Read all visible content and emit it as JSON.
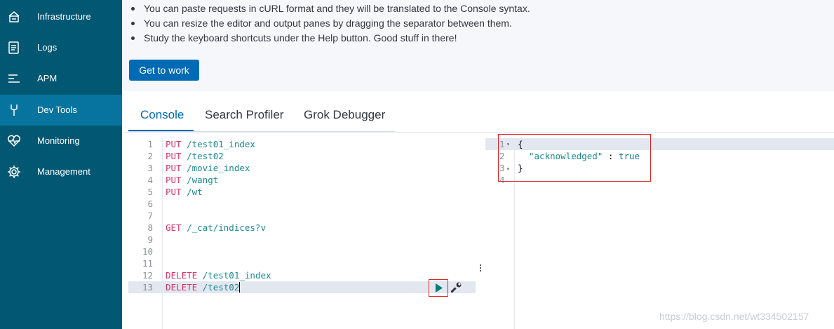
{
  "sidebar": {
    "items": [
      {
        "label": "Infrastructure",
        "icon": "infrastructure-icon"
      },
      {
        "label": "Logs",
        "icon": "logs-icon"
      },
      {
        "label": "APM",
        "icon": "apm-icon"
      },
      {
        "label": "Dev Tools",
        "icon": "wrench-tool-icon",
        "active": true
      },
      {
        "label": "Monitoring",
        "icon": "heartbeat-icon"
      },
      {
        "label": "Management",
        "icon": "gear-icon"
      }
    ]
  },
  "intro": {
    "bullets": [
      "You can paste requests in cURL format and they will be translated to the Console syntax.",
      "You can resize the editor and output panes by dragging the separator between them.",
      "Study the keyboard shortcuts under the Help button. Good stuff in there!"
    ],
    "button_label": "Get to work"
  },
  "tabs": [
    {
      "label": "Console",
      "active": true
    },
    {
      "label": "Search Profiler"
    },
    {
      "label": "Grok Debugger"
    }
  ],
  "editor": {
    "lines": [
      {
        "n": "1",
        "method": "PUT",
        "path": " /test01_index"
      },
      {
        "n": "2",
        "method": "PUT",
        "path": " /test02"
      },
      {
        "n": "3",
        "method": "PUT",
        "path": " /movie_index"
      },
      {
        "n": "4",
        "method": "PUT",
        "path": " /wangt"
      },
      {
        "n": "5",
        "method": "PUT",
        "path": " /wt"
      },
      {
        "n": "6",
        "method": "",
        "path": ""
      },
      {
        "n": "7",
        "method": "",
        "path": ""
      },
      {
        "n": "8",
        "method": "GET",
        "path": " /_cat/indices?v"
      },
      {
        "n": "9",
        "method": "",
        "path": ""
      },
      {
        "n": "10",
        "method": "",
        "path": ""
      },
      {
        "n": "11",
        "method": "",
        "path": ""
      },
      {
        "n": "12",
        "method": "DELETE",
        "path": " /test01_index"
      },
      {
        "n": "13",
        "method": "DELETE",
        "path": " /test02"
      }
    ]
  },
  "output": {
    "lines": [
      {
        "n": "1",
        "text": "{"
      },
      {
        "n": "2",
        "key": "\"acknowledged\"",
        "sep": " : ",
        "value": "true"
      },
      {
        "n": "3",
        "text": "}"
      },
      {
        "n": "4",
        "text": ""
      }
    ]
  },
  "watermark": "https://blog.csdn.net/wt334502157",
  "colors": {
    "sidebar_bg": "#025772",
    "sidebar_active": "#0774a0",
    "accent": "#006bb4",
    "method": "#d6336c",
    "path": "#1b8a8f",
    "highlight_box": "#e02424"
  }
}
